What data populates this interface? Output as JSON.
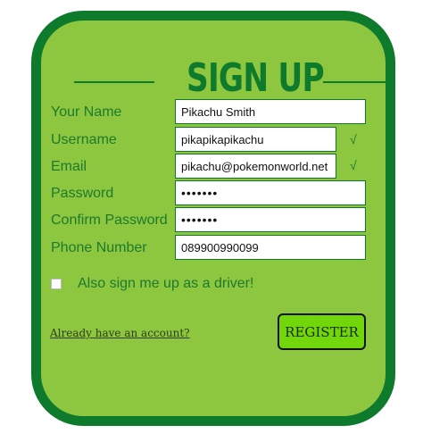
{
  "form": {
    "title": "SIGN UP",
    "fields": [
      {
        "label": "Your Name",
        "value": "Pikachu Smith",
        "valid": false
      },
      {
        "label": "Username",
        "value": "pikapikapikachu",
        "valid": true
      },
      {
        "label": "Email",
        "value": "pikachu@pokemonworld.net",
        "valid": true
      },
      {
        "label": "Password",
        "value": "•••••••",
        "valid": false
      },
      {
        "label": "Confirm Password",
        "value": "•••••••",
        "valid": false
      },
      {
        "label": "Phone Number",
        "value": "089900990099",
        "valid": false
      }
    ],
    "valid_mark": "√",
    "driver_label": "Also sign me up as a driver!",
    "driver_checked": false,
    "login_link": "Already have an account?",
    "register_label": "REGISTER"
  },
  "colors": {
    "card_bg": "#8dc63f",
    "card_border": "#0e7a2c",
    "text": "#1d7a2d",
    "button_bg": "#72d70a"
  }
}
